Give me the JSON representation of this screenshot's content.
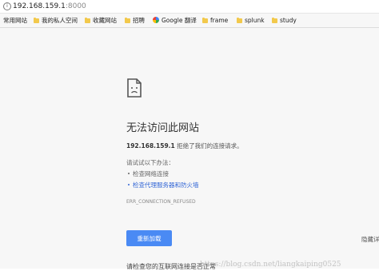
{
  "address_bar": {
    "host": "192.168.159.1",
    "port": ":8000"
  },
  "bookmarks": [
    {
      "label": "常用网站",
      "icon": "folder-icon"
    },
    {
      "label": "我的私人空间",
      "icon": "folder-icon"
    },
    {
      "label": "收藏网站",
      "icon": "folder-icon"
    },
    {
      "label": "招聘",
      "icon": "folder-icon"
    },
    {
      "label": "Google 翻译",
      "icon": "google-icon"
    },
    {
      "label": "frame",
      "icon": "folder-icon"
    },
    {
      "label": "splunk",
      "icon": "folder-icon"
    },
    {
      "label": "study",
      "icon": "folder-icon"
    }
  ],
  "error": {
    "title": "无法访问此网站",
    "host_bold": "192.168.159.1",
    "message_rest": " 拒绝了我们的连接请求。",
    "try_label": "请试试以下办法：",
    "suggestions": [
      "检查网络连接",
      "检查代理服务器和防火墙"
    ],
    "code": "ERR_CONNECTION_REFUSED",
    "reload_label": "重新加载",
    "details_label": "隐藏详",
    "cutoff_line": "请检查您的互联网连接是否正常"
  },
  "watermark": "https://blog.csdn.net/liangkaiping0525",
  "colors": {
    "accent": "#4a8af4",
    "link": "#3367d6",
    "page_bg": "#f7f7f7",
    "folder": "#f2c94c"
  }
}
